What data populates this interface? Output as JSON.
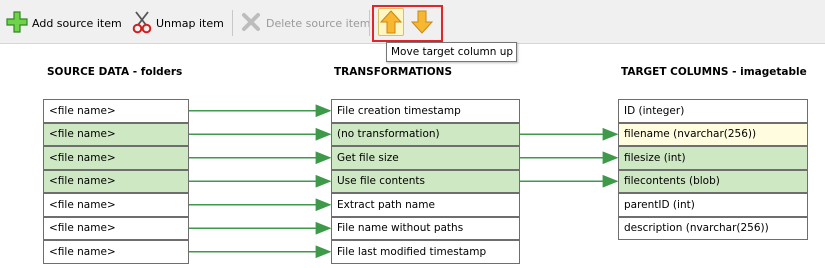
{
  "toolbar": {
    "add_label": "Add source item",
    "unmap_label": "Unmap item",
    "delete_label": "Delete source item",
    "tooltip": "Move target column up"
  },
  "headers": {
    "source": "SOURCE DATA - folders",
    "transform": "TRANSFORMATIONS",
    "target": "TARGET COLUMNS - imagetable"
  },
  "sources": [
    {
      "label": "<file name>",
      "mapped": false
    },
    {
      "label": "<file name>",
      "mapped": true
    },
    {
      "label": "<file name>",
      "mapped": true
    },
    {
      "label": "<file name>",
      "mapped": true
    },
    {
      "label": "<file name>",
      "mapped": false
    },
    {
      "label": "<file name>",
      "mapped": false
    },
    {
      "label": "<file name>",
      "mapped": false
    }
  ],
  "transforms": [
    {
      "label": "File creation timestamp",
      "mapped": false
    },
    {
      "label": "(no transformation)",
      "mapped": true
    },
    {
      "label": "Get file size",
      "mapped": true
    },
    {
      "label": "Use file contents",
      "mapped": true
    },
    {
      "label": "Extract path name",
      "mapped": false
    },
    {
      "label": "File name without paths",
      "mapped": false
    },
    {
      "label": "File last modified timestamp",
      "mapped": false
    }
  ],
  "targets": [
    {
      "label": "ID (integer)",
      "state": "none"
    },
    {
      "label": "filename (nvarchar(256))",
      "state": "selected"
    },
    {
      "label": "filesize (int)",
      "state": "mapped"
    },
    {
      "label": "filecontents (blob)",
      "state": "mapped"
    },
    {
      "label": "parentID (int)",
      "state": "none"
    },
    {
      "label": "description (nvarchar(256))",
      "state": "none"
    }
  ],
  "connections": {
    "source_to_transform": [
      0,
      1,
      2,
      3,
      4,
      5,
      6
    ],
    "transform_to_target": [
      [
        1,
        1
      ],
      [
        2,
        2
      ],
      [
        3,
        3
      ]
    ]
  },
  "colors": {
    "connector": "#3e9a4a",
    "mapped_bg": "#cfe8c4",
    "selected_bg": "#fffce0",
    "highlight_border": "#e0262a"
  },
  "icons": {
    "add": "plus-icon",
    "unmap": "scissors-icon",
    "delete": "delete-x-icon",
    "move_up": "arrow-up-icon",
    "move_down": "arrow-down-icon"
  }
}
